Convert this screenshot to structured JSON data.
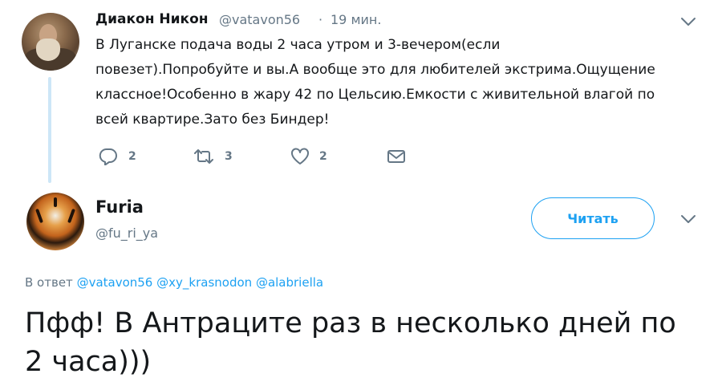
{
  "parent_tweet": {
    "author_name": "Диакон Никон",
    "author_handle": "@vatavon56",
    "separator": "·",
    "timestamp": "19 мин.",
    "text_lines": [
      "В Луганске  подача воды 2 часа утром и 3-вечером(если",
      "повезет).Попробуйте и вы.А вообще это для любителей экстрима.Ощущение",
      "классное!Особенно в жару 42 по Цельсию.Емкости с живительной влагой по",
      "всей квартире.Зато без Биндер!"
    ],
    "actions": {
      "reply_count": "2",
      "retweet_count": "3",
      "like_count": "2"
    }
  },
  "main_tweet": {
    "author_name": "Furia",
    "author_handle": "@fu_ri_ya",
    "follow_label": "Читать",
    "replying_prefix": "В ответ",
    "replying_to": [
      "@vatavon56",
      "@xy_krasnodon",
      "@alabriella"
    ],
    "text_lines": [
      "Пфф! В Антраците раз в несколько дней по",
      "2 часа)))"
    ]
  },
  "icons": {
    "more": "chevron-down-icon",
    "reply": "reply-icon",
    "retweet": "retweet-icon",
    "like": "heart-icon",
    "dm": "envelope-icon"
  },
  "colors": {
    "accent": "#1da1f2",
    "secondary_text": "#657786",
    "thread_line": "#cde6f7"
  }
}
